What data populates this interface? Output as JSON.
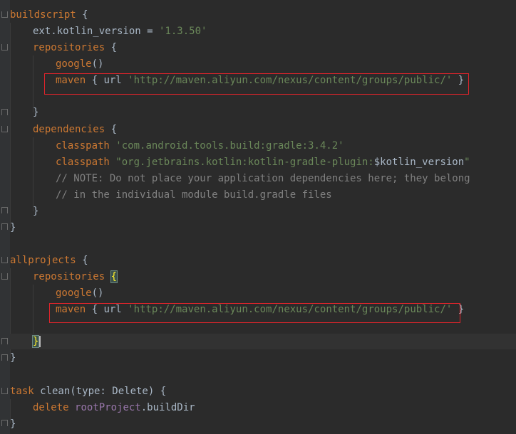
{
  "editor": {
    "lines": {
      "l01": {
        "kw": "buildscript",
        "rest": " {"
      },
      "l02": {
        "plain": "ext.kotlin_version = ",
        "str": "'1.3.50'"
      },
      "l03": {
        "kw": "repositories",
        "rest": " {"
      },
      "l04": {
        "kw": "google",
        "rest": "()"
      },
      "l05": {
        "kw": "maven",
        "mid": " { url ",
        "str": "'http://maven.aliyun.com/nexus/content/groups/public/'",
        "rest": " }"
      },
      "l07": {
        "rest": "}"
      },
      "l08": {
        "kw": "dependencies",
        "rest": " {"
      },
      "l09": {
        "kw": "classpath",
        "str": "'com.android.tools.build:gradle:3.4.2'"
      },
      "l10": {
        "kw": "classpath",
        "str": "\"org.jetbrains.kotlin:kotlin-gradle-plugin:",
        "var": "$kotlin_version",
        "str2": "\""
      },
      "l11": {
        "cmt": "// NOTE: Do not place your application dependencies here; they belong"
      },
      "l12": {
        "cmt": "// in the individual module build.gradle files"
      },
      "l13": {
        "rest": "}"
      },
      "l14": {
        "rest": "}"
      },
      "l16": {
        "kw": "allprojects",
        "rest": " {"
      },
      "l17": {
        "kw": "repositories",
        "brace": "{"
      },
      "l18": {
        "kw": "google",
        "rest": "()"
      },
      "l19": {
        "kw": "maven",
        "mid": " { url ",
        "str": "'http://maven.aliyun.com/nexus/content/groups/public/'",
        "rest": " }"
      },
      "l21": {
        "brace": "}"
      },
      "l22": {
        "rest": "}"
      },
      "l24": {
        "kw": "task",
        "mid": " clean(type: Delete) {"
      },
      "l25": {
        "kw": "delete",
        "prop": "rootProject",
        "rest": ".buildDir"
      },
      "l26": {
        "rest": "}"
      }
    }
  },
  "colors": {
    "background": "#2b2b2b",
    "keyword": "#cc7832",
    "string": "#6a8759",
    "comment": "#808080",
    "annotation_box": "#e0242b"
  }
}
